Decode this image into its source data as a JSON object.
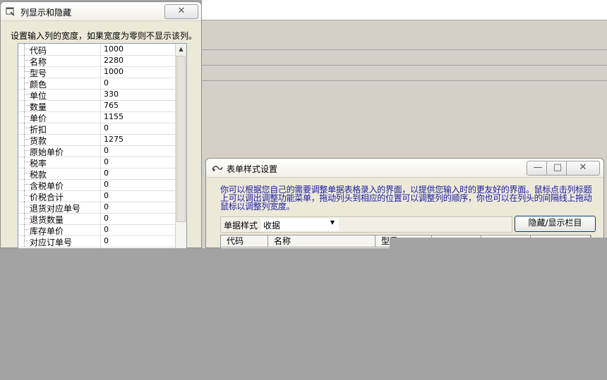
{
  "columns_dialog": {
    "title": "列显示和隐藏",
    "description": "设置输入列的宽度，如果宽度为零则不显示该列。",
    "close_label": "✕",
    "columns": [
      {
        "name": "代码",
        "width": "1000"
      },
      {
        "name": "名称",
        "width": "2280"
      },
      {
        "name": "型号",
        "width": "1000"
      },
      {
        "name": "颜色",
        "width": "0"
      },
      {
        "name": "单位",
        "width": "330"
      },
      {
        "name": "数量",
        "width": "765"
      },
      {
        "name": "单价",
        "width": "1155"
      },
      {
        "name": "折扣",
        "width": "0"
      },
      {
        "name": "货款",
        "width": "1275"
      },
      {
        "name": "原始单价",
        "width": "0"
      },
      {
        "name": "税率",
        "width": "0"
      },
      {
        "name": "税款",
        "width": "0"
      },
      {
        "name": "含税单价",
        "width": "0"
      },
      {
        "name": "价税合计",
        "width": "0"
      },
      {
        "name": "退货对应单号",
        "width": "0"
      },
      {
        "name": "退货数量",
        "width": "0"
      },
      {
        "name": "库存单价",
        "width": "0"
      },
      {
        "name": "对应订单号",
        "width": "0"
      }
    ]
  },
  "form_dialog": {
    "title": "表单样式设置",
    "description": "你可以根据您自己的需要调整单据表格录入的界面，以提供您输入时的更友好的界面。鼠标点击列标题上可以调出调整功能菜单，拖动列头到相应的位置可以调整列的顺序，你也可以在列头的间隔线上拖动鼠标以调整列宽度。",
    "style_label": "单据样式",
    "style_value": "收据",
    "toggle_button": "隐藏/显示栏目",
    "grid_headers": [
      "代码",
      "名称",
      "型号"
    ],
    "minimize_label": "—",
    "maximize_label": "□",
    "close_label": "✕"
  },
  "colors": {
    "dialog_bg": "#ece9d8",
    "description_text": "#1a1aa0",
    "occluded_area": "#a3a3a3"
  }
}
